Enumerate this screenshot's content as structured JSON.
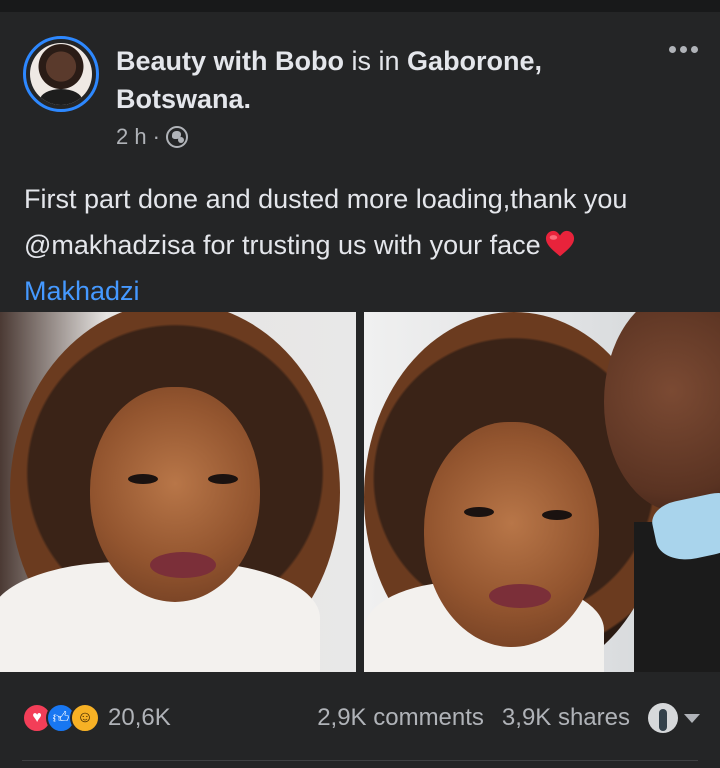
{
  "post": {
    "author": "Beauty with Bobo",
    "location_prefix": "is in",
    "location_city": "Gaborone,",
    "location_country": "Botswana.",
    "time": "2 h",
    "dot": "·",
    "audience_icon": "globe-icon",
    "caption_line1": "First part done and dusted more loading,thank you",
    "caption_line2": "@makhadzisa  for trusting us with  your face",
    "caption_emoji": "red-heart-icon",
    "tag": "Makhadzi"
  },
  "photos": [
    {
      "name": "photo-left"
    },
    {
      "name": "photo-right"
    }
  ],
  "stats": {
    "reaction_icons": [
      "love",
      "like",
      "wow"
    ],
    "reactions_count": "20,6K",
    "comments": "2,9K comments",
    "shares": "3,9K shares"
  },
  "colors": {
    "background": "#18191a",
    "card": "#242526",
    "text": "#e4e6eb",
    "secondary": "#b0b3b8",
    "link": "#4599ff",
    "avatar_ring": "#2d88ff"
  }
}
